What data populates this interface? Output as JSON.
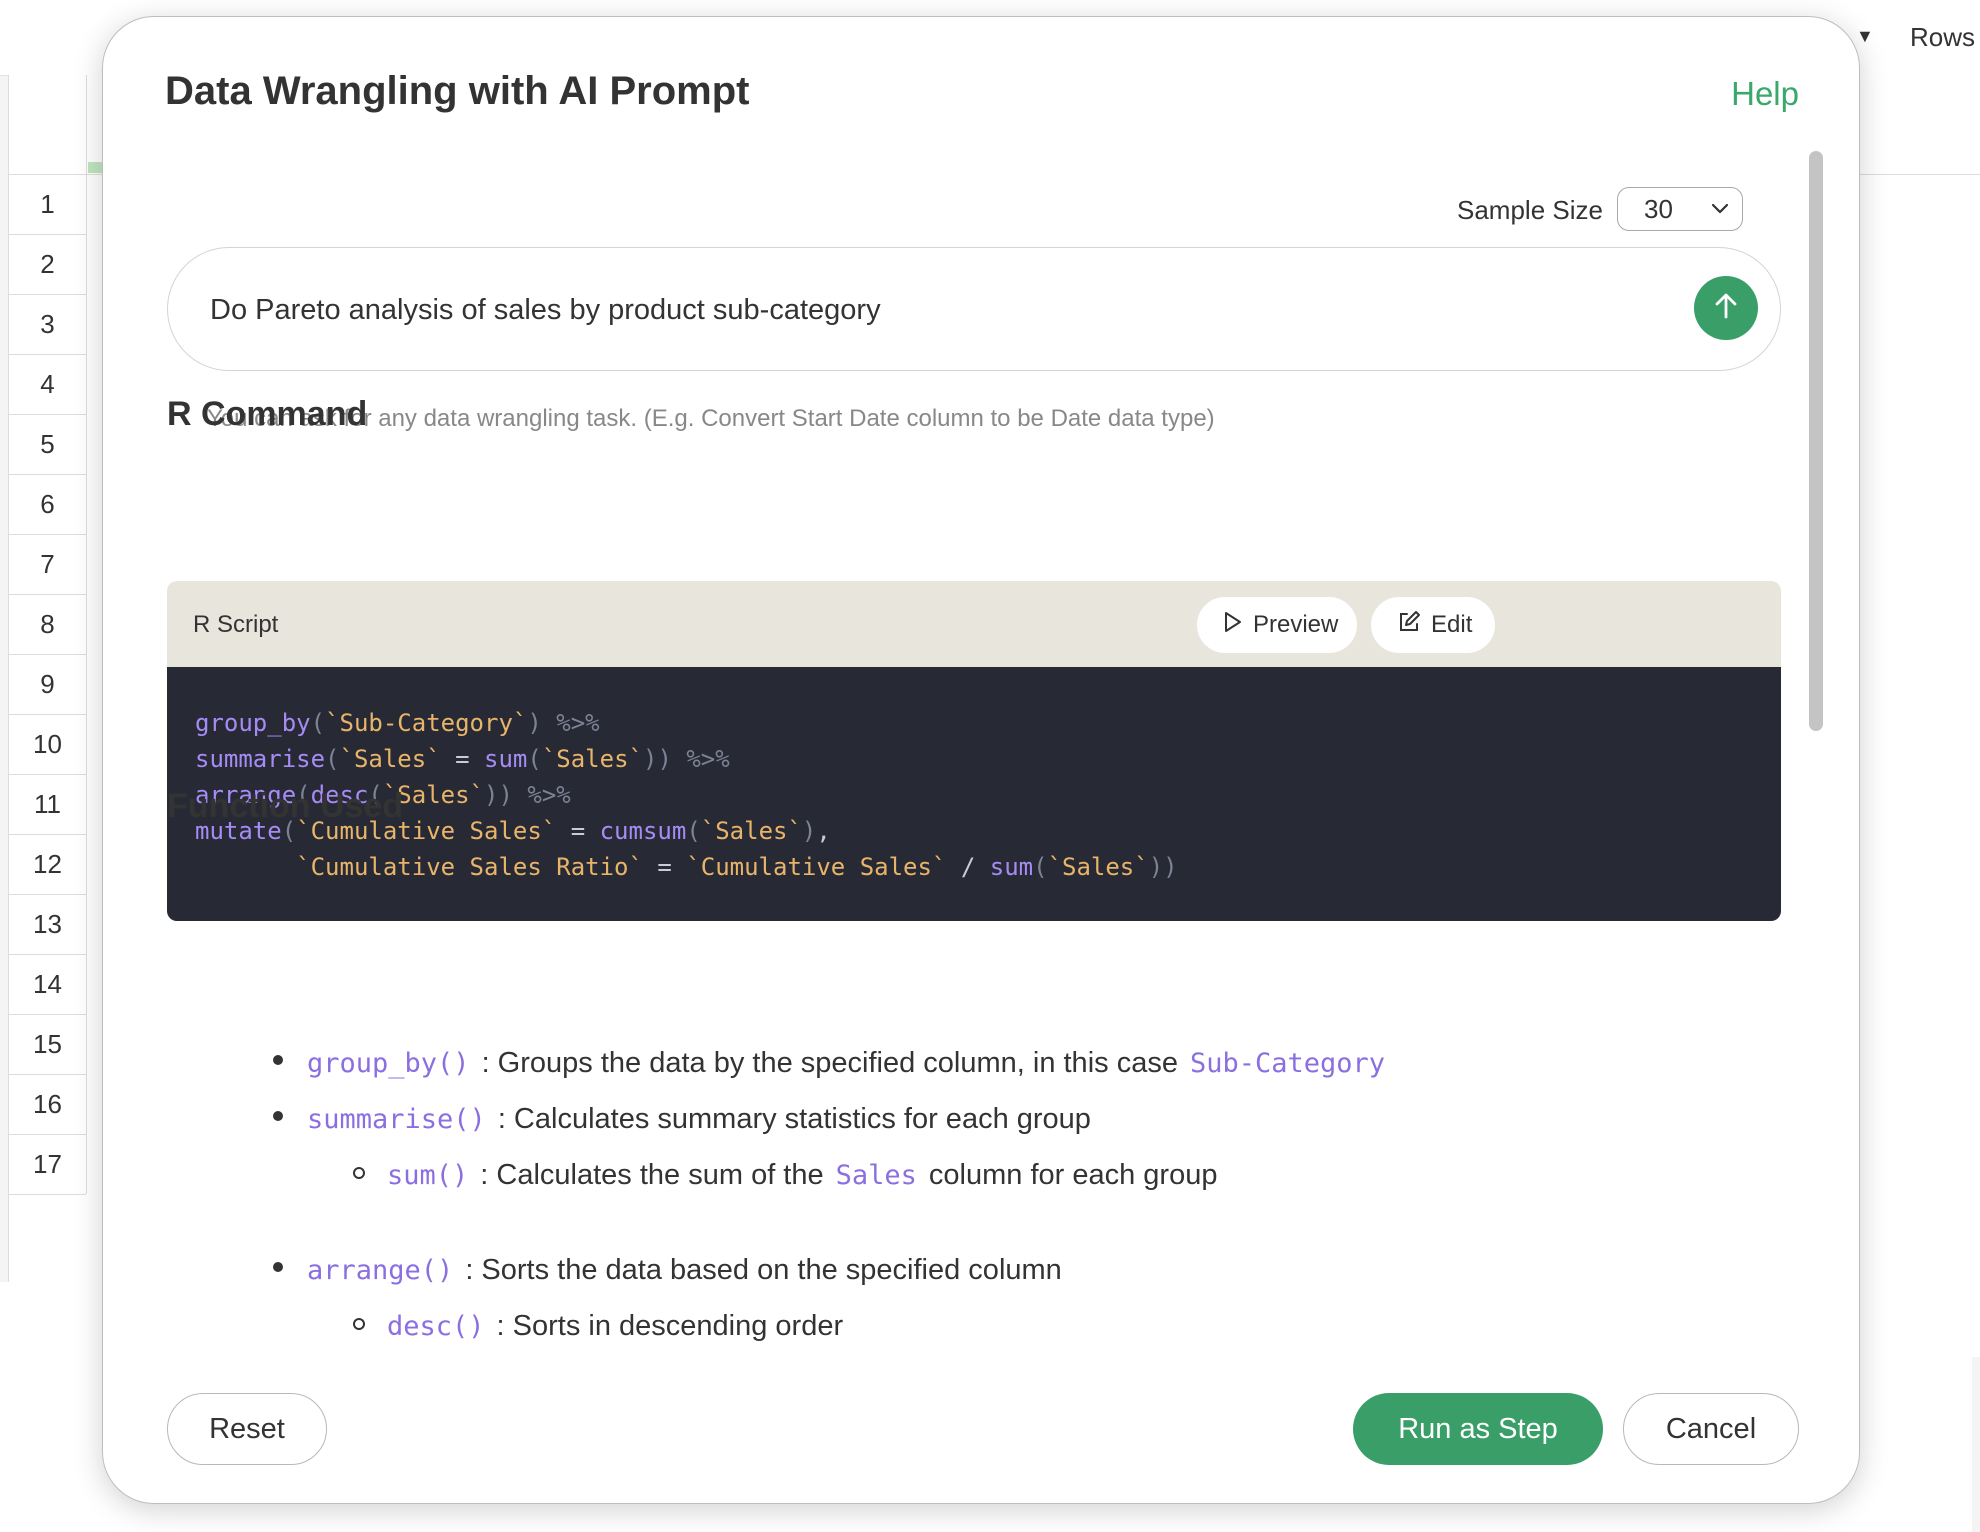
{
  "background": {
    "rows_label": "Rows",
    "row_numbers": [
      "1",
      "2",
      "3",
      "4",
      "5",
      "6",
      "7",
      "8",
      "9",
      "10",
      "11",
      "12",
      "13",
      "14",
      "15",
      "16",
      "17"
    ]
  },
  "modal": {
    "title": "Data Wrangling with AI Prompt",
    "help_label": "Help",
    "sample_size": {
      "label": "Sample Size",
      "value": "30"
    },
    "prompt": {
      "value": "Do Pareto analysis of sales by product sub-category",
      "hint": "You can ask for any data wrangling task. (E.g. Convert Start Date column to be Date data type)"
    },
    "r_command": {
      "heading": "R Command",
      "card_label": "R Script",
      "preview_label": "Preview",
      "edit_label": "Edit",
      "code_lines": [
        "group_by(`Sub-Category`) %>%",
        "summarise(`Sales` = sum(`Sales`)) %>%",
        "arrange(desc(`Sales`)) %>%",
        "mutate(`Cumulative Sales` = cumsum(`Sales`),",
        "       `Cumulative Sales Ratio` = `Cumulative Sales` / sum(`Sales`))"
      ]
    },
    "functions": {
      "heading": "Function Used",
      "items": [
        {
          "code": "group_by()",
          "text": ": Groups the data by the specified column, in this case",
          "code2": "Sub-Category",
          "text2": ""
        },
        {
          "code": "summarise()",
          "text": ": Calculates summary statistics for each group"
        },
        {
          "code": "sum()",
          "text": ": Calculates the sum of the",
          "code2": "Sales",
          "text2": "column for each group"
        },
        {
          "code": "arrange()",
          "text": ": Sorts the data based on the specified column"
        },
        {
          "code": "desc()",
          "text": ": Sorts in descending order"
        }
      ]
    },
    "buttons": {
      "reset": "Reset",
      "run": "Run as Step",
      "cancel": "Cancel"
    },
    "colors": {
      "accent_green": "#3a9e68",
      "code_function": "#a78bf5",
      "code_string": "#e8b46a",
      "code_bg": "#272a35"
    }
  }
}
